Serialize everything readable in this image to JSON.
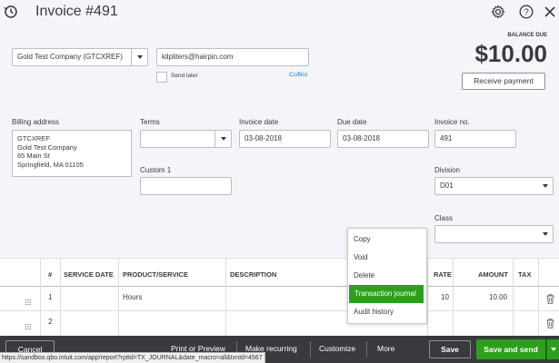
{
  "header": {
    "title": "Invoice #491"
  },
  "customer": {
    "value": "Gold Test Company (GTCXREF)"
  },
  "email": {
    "value": "kilpliters@hairpin.com",
    "send_later": "Send later",
    "ccbcc": "Cc/Bcc"
  },
  "balance": {
    "label": "BALANCE DUE",
    "amount": "$10.00",
    "receive_payment": "Receive payment"
  },
  "billing": {
    "label": "Billing address",
    "lines": [
      "GTCXREF",
      "Gold Test Company",
      "65 Main St",
      "Springfield, MA  01105"
    ]
  },
  "terms": {
    "label": "Terms",
    "value": ""
  },
  "invoice_date": {
    "label": "Invoice date",
    "value": "03-08-2018"
  },
  "due_date": {
    "label": "Due date",
    "value": "03-08-2018"
  },
  "invoice_no": {
    "label": "Invoice no.",
    "value": "491"
  },
  "custom1": {
    "label": "Custom 1",
    "value": ""
  },
  "division": {
    "label": "Division",
    "value": "D01"
  },
  "class_field": {
    "label": "Class",
    "value": ""
  },
  "table": {
    "headers": {
      "num": "#",
      "service_date": "SERVICE DATE",
      "product": "PRODUCT/SERVICE",
      "description": "DESCRIPTION",
      "rate": "RATE",
      "amount": "AMOUNT",
      "tax": "TAX"
    },
    "rows": [
      {
        "num": "1",
        "product": "Hours",
        "rate": "10",
        "amount": "10.00"
      },
      {
        "num": "2",
        "product": "",
        "rate": "",
        "amount": ""
      }
    ]
  },
  "more_menu": {
    "items": [
      "Copy",
      "Void",
      "Delete",
      "Transaction journal",
      "Audit history"
    ],
    "highlighted": "Transaction journal"
  },
  "bottom_bar": {
    "cancel": "Cancel",
    "print": "Print or Preview",
    "recurring": "Make recurring",
    "customize": "Customize",
    "more": "More",
    "save": "Save",
    "save_send": "Save and send"
  },
  "status_url": "https://sandbox.qbo.intuit.com/app/report?rptId=TX_JOURNAL&date_macro=all&txnId=4567",
  "colors": {
    "accent_green": "#2ca01c",
    "bottom_bar": "#393a3d",
    "bg": "#f4f5f8"
  },
  "icons": [
    "history-icon",
    "gear-icon",
    "help-icon",
    "close-icon",
    "trash-icon",
    "drag-handle-icon"
  ]
}
